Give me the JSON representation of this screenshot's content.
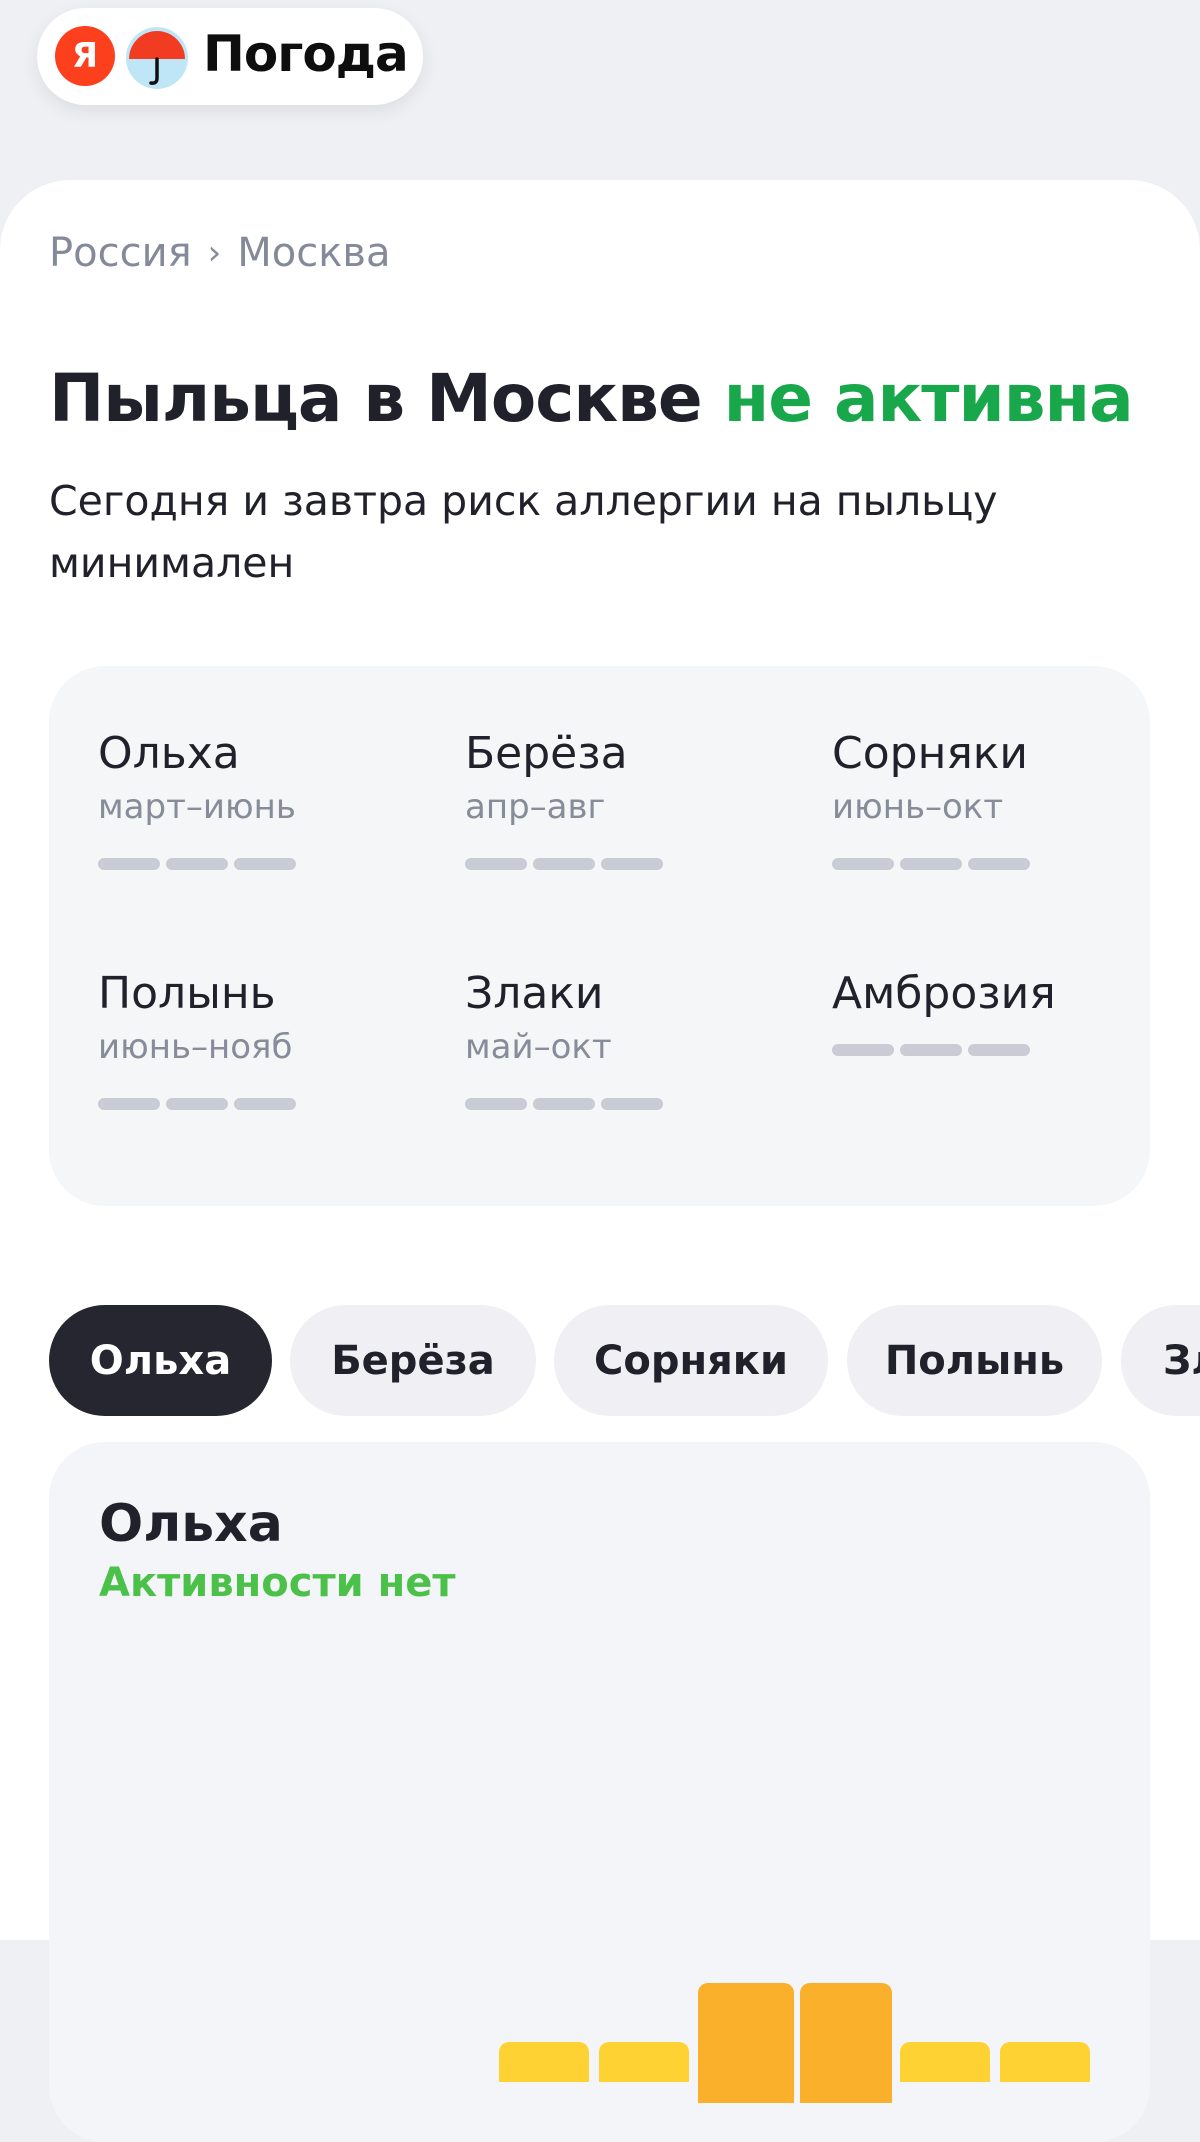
{
  "header": {
    "logo_letter": "Я",
    "brand": "Погода"
  },
  "breadcrumb": {
    "country": "Россия",
    "separator": "›",
    "city": "Москва"
  },
  "title": {
    "main": "Пыльца в Москве",
    "status": "не активна"
  },
  "subtitle": "Сегодня и завтра риск аллергии на пыльцу минимален",
  "plants": [
    {
      "name": "Ольха",
      "season": "март–июнь"
    },
    {
      "name": "Берёза",
      "season": "апр–авг"
    },
    {
      "name": "Сорняки",
      "season": "июнь–окт"
    },
    {
      "name": "Полынь",
      "season": "июнь–нояб"
    },
    {
      "name": "Злаки",
      "season": "май–окт"
    },
    {
      "name": "Амброзия",
      "season": ""
    }
  ],
  "tabs": [
    {
      "label": "Ольха",
      "active": true
    },
    {
      "label": "Берёза",
      "active": false
    },
    {
      "label": "Сорняки",
      "active": false
    },
    {
      "label": "Полынь",
      "active": false
    },
    {
      "label": "Зл",
      "active": false
    }
  ],
  "detail": {
    "title": "Ольха",
    "status": "Активности нет"
  },
  "colors": {
    "accent_green": "#18a84b",
    "status_green": "#4cc14a",
    "active_tab": "#262631",
    "bar_orange": "#fbb02b",
    "bar_yellow": "#ffd233"
  }
}
